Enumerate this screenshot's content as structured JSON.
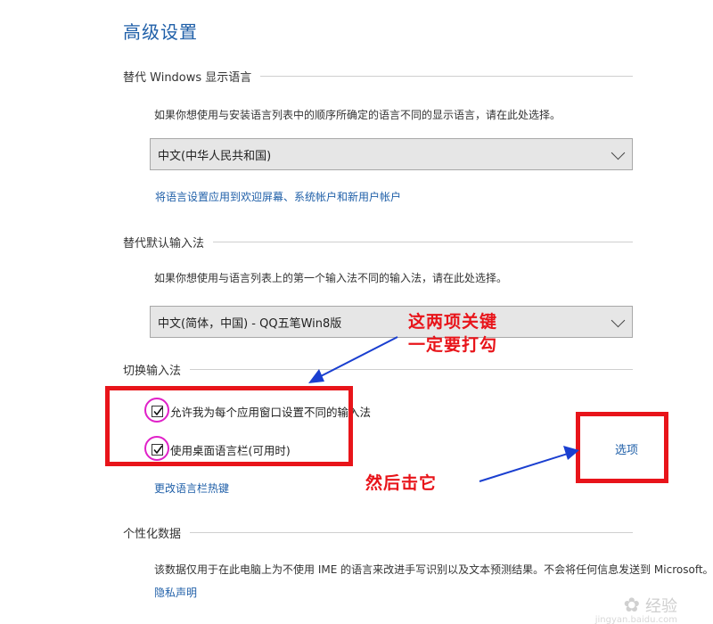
{
  "title": "高级设置",
  "display_lang": {
    "heading": "替代 Windows 显示语言",
    "desc": "如果你想使用与安装语言列表中的顺序所确定的语言不同的显示语言，请在此处选择。",
    "selected": "中文(中华人民共和国)",
    "apply_link": "将语言设置应用到欢迎屏幕、系统帐户和新用户帐户"
  },
  "input_method": {
    "heading": "替代默认输入法",
    "desc": "如果你想使用与语言列表上的第一个输入法不同的输入法，请在此处选择。",
    "selected": "中文(简体，中国) - QQ五笔Win8版"
  },
  "switch": {
    "heading": "切换输入法",
    "check1": "允许我为每个应用窗口设置不同的输入法",
    "check2": "使用桌面语言栏(可用时)",
    "hotkey_link": "更改语言栏热键",
    "options_link": "选项"
  },
  "personal": {
    "heading": "个性化数据",
    "desc": "该数据仅用于在此电脑上为不使用 IME 的语言来改进手写识别以及文本预测结果。不会将任何信息发送到 Microsoft。",
    "privacy_link": "隐私声明"
  },
  "annotations": {
    "note1_line1": "这两项关键",
    "note1_line2": "一定要打勾",
    "note2": "然后击它"
  },
  "watermark": {
    "text": "经验",
    "sub": "jingyan.baidu.com"
  },
  "colors": {
    "accent": "#1f5fa8",
    "annotation_red": "#e8141a",
    "annotation_blue": "#1a3fd0",
    "annotation_magenta": "#e020c8"
  }
}
